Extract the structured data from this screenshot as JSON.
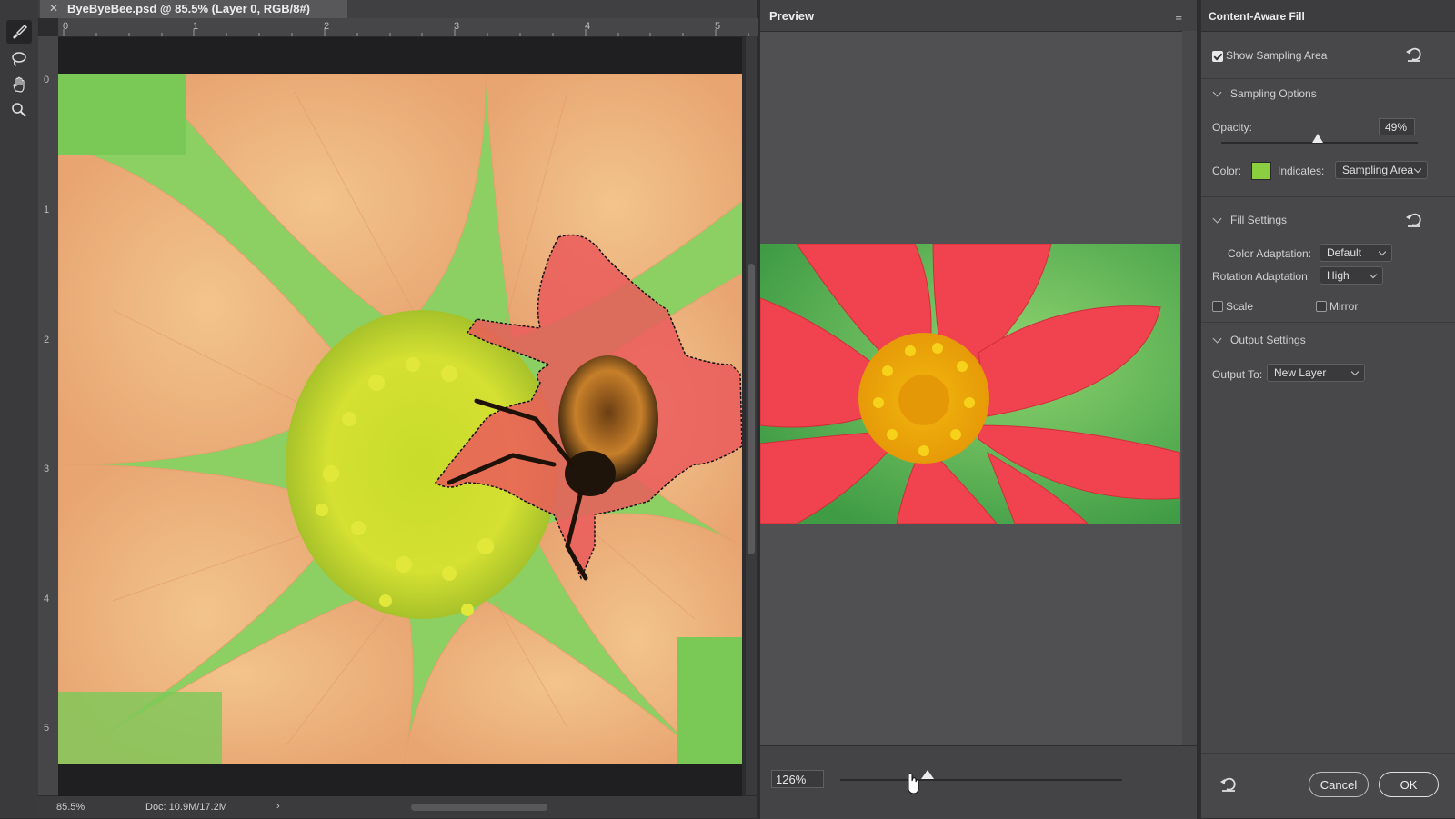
{
  "document": {
    "tab_title": "ByeByeBee.psd @ 85.5% (Layer 0, RGB/8#)",
    "ruler_top": [
      "0",
      "1",
      "2",
      "3",
      "4",
      "5"
    ],
    "ruler_left": [
      "0",
      "1",
      "2",
      "3",
      "4",
      "5"
    ],
    "status_zoom": "85.5%",
    "status_doc": "Doc: 10.9M/17.2M",
    "status_arrow": "›"
  },
  "tools": [
    "sampling-brush-icon",
    "lasso-icon",
    "hand-icon",
    "zoom-icon"
  ],
  "preview": {
    "title": "Preview",
    "menu_icon": "≡",
    "zoom_value": "126%",
    "zoom_slider_fraction": 0.31
  },
  "caf": {
    "title": "Content-Aware Fill",
    "show_sampling_area": "Show Sampling Area",
    "show_sampling_checked": true,
    "sampling_options": "Sampling Options",
    "opacity_label": "Opacity:",
    "opacity_value": "49%",
    "opacity_fraction": 0.49,
    "color_label": "Color:",
    "color_value": "#8bcf40",
    "indicates_label": "Indicates:",
    "indicates_value": "Sampling Area",
    "fill_settings": "Fill Settings",
    "color_adaptation_label": "Color Adaptation:",
    "color_adaptation_value": "Default",
    "rotation_adaptation_label": "Rotation Adaptation:",
    "rotation_adaptation_value": "High",
    "scale_label": "Scale",
    "mirror_label": "Mirror",
    "output_settings": "Output Settings",
    "output_to_label": "Output To:",
    "output_to_value": "New Layer",
    "cancel": "Cancel",
    "ok": "OK"
  }
}
